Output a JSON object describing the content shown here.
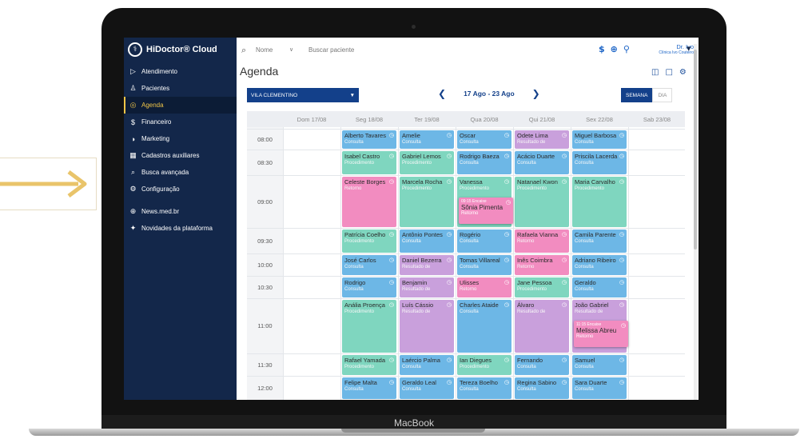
{
  "device": {
    "label": "MacBook"
  },
  "app": {
    "name": "HiDoctor® Cloud"
  },
  "sidebar": {
    "items": [
      {
        "label": "Atendimento",
        "icon": "play-outline-icon",
        "glyph": "▷"
      },
      {
        "label": "Pacientes",
        "icon": "user-icon",
        "glyph": "♙"
      },
      {
        "label": "Agenda",
        "icon": "calendar-icon",
        "glyph": "◎",
        "active": true
      },
      {
        "label": "Financeiro",
        "icon": "dollar-icon",
        "glyph": "$"
      },
      {
        "label": "Marketing",
        "icon": "megaphone-icon",
        "glyph": "◑"
      },
      {
        "label": "Cadastros auxiliares",
        "icon": "grid-icon",
        "glyph": "▦"
      },
      {
        "label": "Busca avançada",
        "icon": "search-icon",
        "glyph": "⌕"
      },
      {
        "label": "Configuração",
        "icon": "gear-icon",
        "glyph": "⚙"
      },
      {
        "label": "News.med.br",
        "icon": "globe-icon",
        "glyph": "⊕"
      },
      {
        "label": "Novidades da plataforma",
        "icon": "sparkle-icon",
        "glyph": "✦"
      }
    ]
  },
  "topbar": {
    "search_field": "Nome",
    "search_placeholder": "Buscar paciente",
    "user_name": "Dr. Ivo",
    "clinic": "Clínica Ivo Couteiro"
  },
  "page": {
    "title": "Agenda"
  },
  "toolbar": {
    "location": "VILA CLEMENTINO",
    "date_range": "17 Ago - 23 Ago",
    "view_week": "SEMANA",
    "view_day": "DIA"
  },
  "calendar": {
    "days": [
      "Dom 17/08",
      "Seg 18/08",
      "Ter 19/08",
      "Qua 20/08",
      "Qui 21/08",
      "Sex 22/08",
      "Sab 23/08"
    ],
    "times": [
      "08:00",
      "08:30",
      "09:00",
      "09:30",
      "10:00",
      "10:30",
      "11:00",
      "11:30",
      "12:00"
    ],
    "rows": [
      [
        null,
        [
          "Alberto Tavares",
          "Consulta",
          "blue"
        ],
        [
          "Amelie",
          "Consulta",
          "blue"
        ],
        [
          "Oscar",
          "Consulta",
          "blue"
        ],
        [
          "Odete Lima",
          "Resultado de",
          "purple"
        ],
        [
          "Miguel Barbosa",
          "Consulta",
          "blue"
        ],
        null
      ],
      [
        null,
        [
          "Isabel Castro",
          "Procedimento",
          "green"
        ],
        [
          "Gabriel Lemos",
          "Procedimento",
          "green"
        ],
        [
          "Rodrigo Baeza",
          "Consulta",
          "blue"
        ],
        [
          "Acácio Duarte",
          "Consulta",
          "blue"
        ],
        [
          "Priscila Lacerda",
          "Consulta",
          "blue"
        ],
        null
      ],
      [
        null,
        [
          "Celeste Borges",
          "Retorno",
          "pink"
        ],
        [
          "Marcela Rocha",
          "Procedimento",
          "green"
        ],
        [
          "Vanessa",
          "Procedimento",
          "green"
        ],
        [
          "Natanael Kwon",
          "Procedimento",
          "green"
        ],
        [
          "Maria Carvalho",
          "Procedimento",
          "green"
        ],
        null
      ],
      [
        null,
        [
          "Patrícia Coelho",
          "Procedimento",
          "green"
        ],
        [
          "Antônio Pontes",
          "Consulta",
          "blue"
        ],
        [
          "Rogério",
          "Consulta",
          "blue"
        ],
        [
          "Rafaela Vianna",
          "Retorno",
          "pink"
        ],
        [
          "Camila Parente",
          "Consulta",
          "blue"
        ],
        null
      ],
      [
        null,
        [
          "José Carlos",
          "Consulta",
          "blue"
        ],
        [
          "Daniel Bezerra",
          "Resultado de",
          "purple"
        ],
        [
          "Tomas Villareal",
          "Consulta",
          "blue"
        ],
        [
          "Inês Coimbra",
          "Retorno",
          "pink"
        ],
        [
          "Adriano Ribeiro",
          "Consulta",
          "blue"
        ],
        null
      ],
      [
        null,
        [
          "Rodrigo",
          "Consulta",
          "blue"
        ],
        [
          "Benjamin",
          "Resultado de",
          "purple"
        ],
        [
          "Ulisses",
          "Retorno",
          "pink"
        ],
        [
          "Jane Pessoa",
          "Procedimento",
          "green"
        ],
        [
          "Geraldo",
          "Consulta",
          "blue"
        ],
        null
      ],
      [
        null,
        [
          "Anália Proença",
          "Procedimento",
          "green"
        ],
        [
          "Luís Cássio",
          "Resultado de",
          "purple"
        ],
        [
          "Charles Ataide",
          "Consulta",
          "blue"
        ],
        [
          "Álvaro",
          "Resultado de",
          "purple"
        ],
        [
          "João Gabriel",
          "Resultado de",
          "purple"
        ],
        null
      ],
      [
        null,
        [
          "Rafael Yamada",
          "Procedimento",
          "green"
        ],
        [
          "Laércio Palma",
          "Consulta",
          "blue"
        ],
        [
          "Ian Diegues",
          "Procedimento",
          "green"
        ],
        [
          "Fernando",
          "Consulta",
          "blue"
        ],
        [
          "Samuel",
          "Consulta",
          "blue"
        ],
        null
      ],
      [
        null,
        [
          "Felipe Malta",
          "Consulta",
          "blue"
        ],
        [
          "Geraldo Leal",
          "Consulta",
          "blue"
        ],
        [
          "Tereza Boelho",
          "Consulta",
          "blue"
        ],
        [
          "Regina Sabino",
          "Consulta",
          "blue"
        ],
        [
          "Sara Duarte",
          "Consulta",
          "blue"
        ],
        null
      ]
    ],
    "encaixes": [
      {
        "header": "09:15 Encaixe",
        "name": "Sônia Pimenta",
        "type": "Retorno",
        "day": 3,
        "row": 2
      },
      {
        "header": "11:15 Encaixe",
        "name": "Melissa Abreu",
        "type": "Retorno",
        "day": 5,
        "row": 6
      }
    ]
  },
  "colors": {
    "blue": "#6db7e6",
    "green": "#7fd6bf",
    "pink": "#f28cc0",
    "purple": "#c9a0dc",
    "sidebar": "#13274a",
    "accent": "#f0c548",
    "primary": "#13408a"
  }
}
